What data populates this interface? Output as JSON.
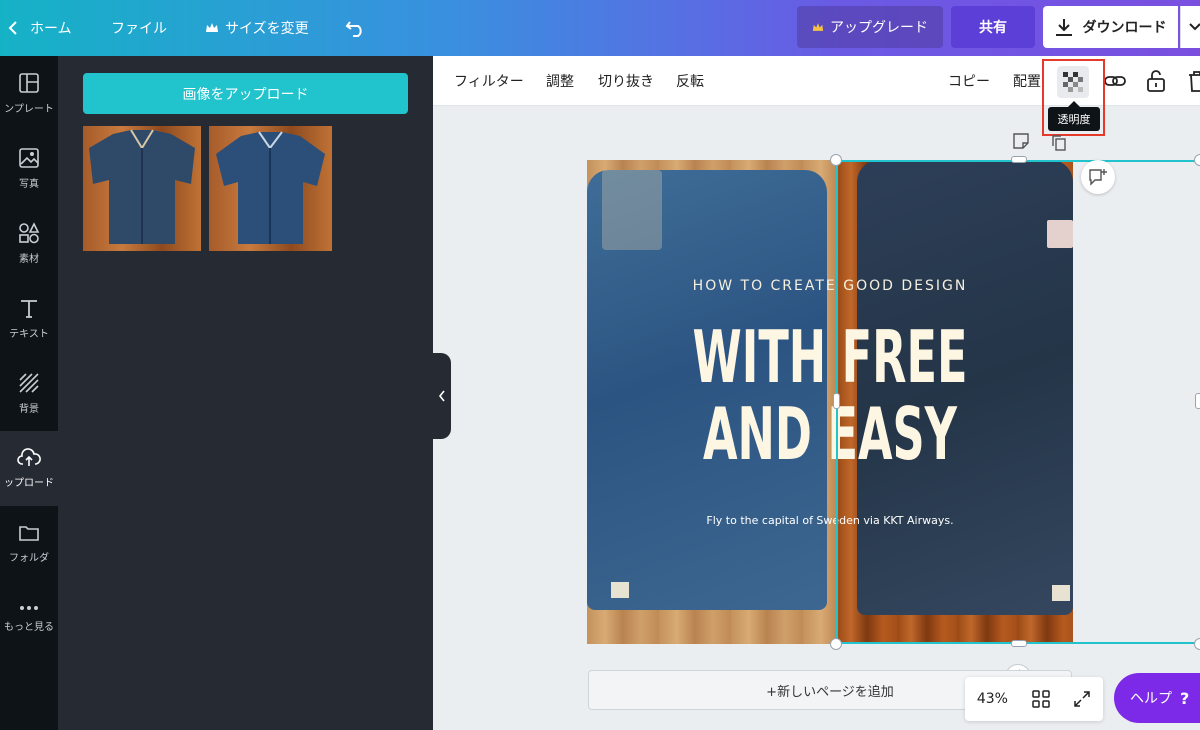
{
  "topbar": {
    "home_label": "ホーム",
    "file_label": "ファイル",
    "resize_label": "サイズを変更",
    "upgrade_label": "アップグレード",
    "share_label": "共有",
    "download_label": "ダウンロード"
  },
  "leftnav": {
    "items": [
      {
        "label": "ンプレート",
        "icon": "template-icon"
      },
      {
        "label": "写真",
        "icon": "photo-icon"
      },
      {
        "label": "素材",
        "icon": "elements-icon"
      },
      {
        "label": "テキスト",
        "icon": "text-icon"
      },
      {
        "label": "背景",
        "icon": "background-icon"
      },
      {
        "label": "ップロード",
        "icon": "upload-icon"
      },
      {
        "label": "フォルダ",
        "icon": "folder-icon"
      },
      {
        "label": "もっと見る",
        "icon": "more-icon"
      }
    ]
  },
  "sidepanel": {
    "upload_button_label": "画像をアップロード"
  },
  "toolbar": {
    "filter": "フィルター",
    "adjust": "調整",
    "crop": "切り抜き",
    "flip": "反転",
    "copy": "コピー",
    "arrange": "配置",
    "transparency_tooltip": "透明度"
  },
  "canvas": {
    "subtitle": "HOW TO CREATE GOOD DESIGN",
    "headline_line1": "WITH FREE",
    "headline_line2": "AND EASY",
    "tagline": "Fly to the capital of Sweden via KKT Airways."
  },
  "footer": {
    "add_page_label": "+新しいページを追加",
    "zoom_level": "43%",
    "help_label": "ヘルプ",
    "help_icon_glyph": "?"
  },
  "colors": {
    "accent_teal": "#21c4cc",
    "share_purple": "#5b3fd6",
    "help_purple": "#7d2ae8",
    "highlight_red": "#e5392b"
  }
}
